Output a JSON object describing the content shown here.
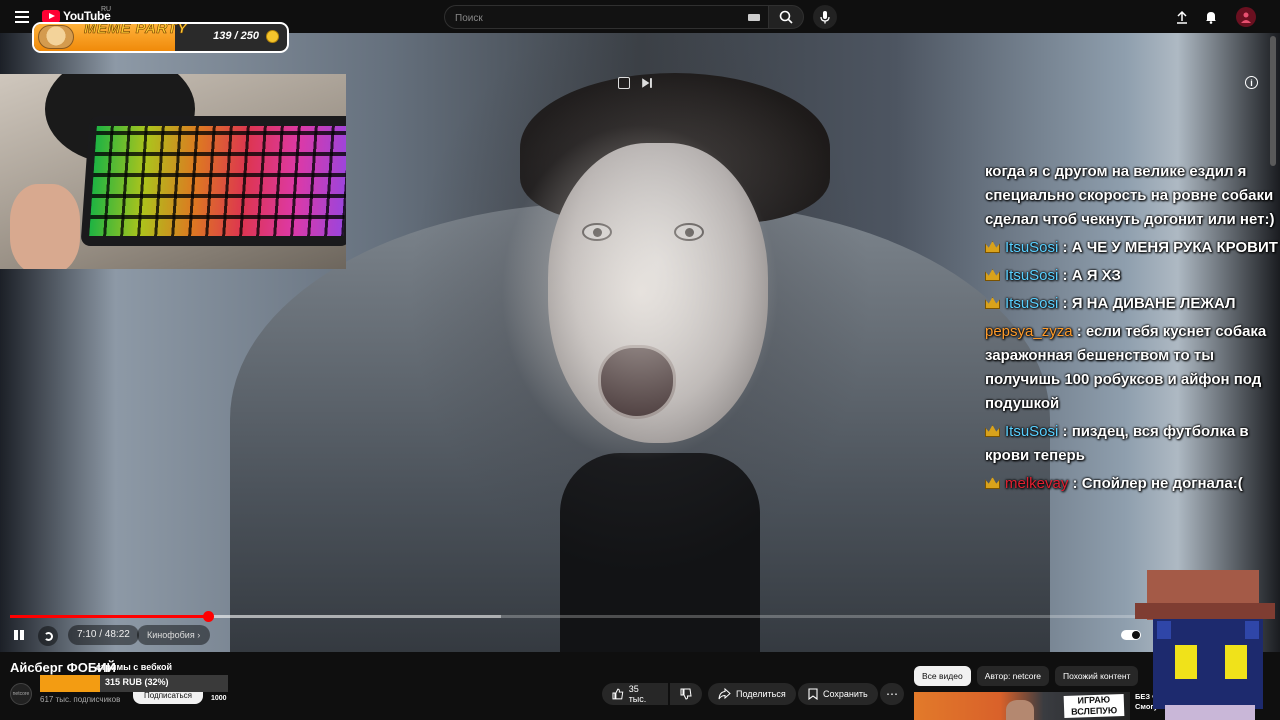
{
  "header": {
    "logo_text": "YouTube",
    "region": "RU",
    "search_placeholder": "Поиск",
    "icons": [
      "menu-icon",
      "keyboard-icon",
      "search-icon",
      "mic-icon",
      "upload-icon",
      "bell-icon",
      "avatar"
    ]
  },
  "meme_party": {
    "title": "MEME PARTY",
    "count": "139 / 250",
    "progress": 0.556,
    "accent": "#f39c12"
  },
  "chat": {
    "top_cut": "когда я с другом на велике ездил я",
    "messages": [
      {
        "nick": "",
        "text": "когда я с другом на велике ездил я специально скорость на ровне собаки сделал чтоб чекнуть догонит или нет:)",
        "crown": false,
        "color": "none"
      },
      {
        "nick": "ItsuSosi",
        "text": ": А ЧЕ У МЕНЯ РУКА КРОВИТ",
        "crown": true,
        "color": "blue"
      },
      {
        "nick": "ItsuSosi",
        "text": ": А Я ХЗ",
        "crown": true,
        "color": "blue"
      },
      {
        "nick": "ItsuSosi",
        "text": ": Я НА ДИВАНЕ ЛЕЖАЛ",
        "crown": true,
        "color": "blue"
      },
      {
        "nick": "pepsya_zyza",
        "text": ": если тебя куснет собака заражонная бешенством то ты получишь 100 робуксов и айфон под подушкой",
        "crown": false,
        "color": "orange"
      },
      {
        "nick": "ItsuSosi",
        "text": ": пиздец, вся футболка в крови теперь",
        "crown": true,
        "color": "blue"
      },
      {
        "nick": "melkevay",
        "text": ": Спойлер не догнала:(",
        "crown": true,
        "color": "red"
      }
    ]
  },
  "player": {
    "time": "7:10 / 48:22",
    "chapter": "Кинофобия",
    "progress_played": 0.157,
    "progress_buffered": 0.39,
    "progress_color": "#ff0000"
  },
  "video_info": {
    "title": "Айсберг ФОБИЙ",
    "subtitle": "стримы с вебкой",
    "donation": "315 RUB (32%)",
    "donation_progress": 0.32,
    "subscribers": "617 тыс. подписчиков",
    "subscribe_label": "Подписаться",
    "count_badge": "1000",
    "channel_avatar_text": "netcore"
  },
  "actions": {
    "likes": "35 тыс.",
    "share": "Поделиться",
    "save": "Сохранить"
  },
  "recommendations": {
    "chips": [
      "Все видео",
      "Автор: netcore",
      "Похожий контент"
    ],
    "thumb_tag": "ИГРАЮ ВСЛЕПУЮ",
    "thumb_title": "БЕЗ ФЕЙ Смогут ли"
  }
}
